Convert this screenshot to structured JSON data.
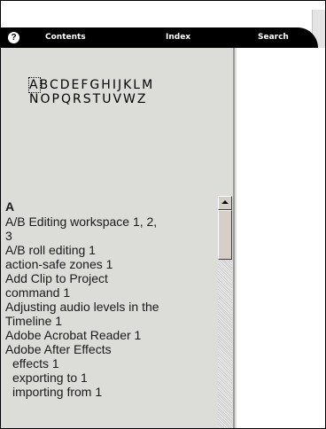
{
  "nav": {
    "help_glyph": "?",
    "contents": "Contents",
    "index": "Index",
    "search": "Search"
  },
  "alphabet": {
    "row1": [
      "A",
      "B",
      "C",
      "D",
      "E",
      "F",
      "G",
      "H",
      "I",
      "J",
      "K",
      "L",
      "M"
    ],
    "row2": [
      "N",
      "O",
      "P",
      "Q",
      "R",
      "S",
      "T",
      "U",
      "V",
      "W",
      "Z"
    ]
  },
  "index": {
    "letter": "A",
    "entries": [
      {
        "text": "A/B Editing workspace 1, 2,",
        "sub": false
      },
      {
        "text": "3",
        "sub": false
      },
      {
        "text": "A/B roll editing 1",
        "sub": false
      },
      {
        "text": "action-safe zones 1",
        "sub": false
      },
      {
        "text": "Add Clip to Project",
        "sub": false
      },
      {
        "text": "command 1",
        "sub": false
      },
      {
        "text": "Adjusting audio levels in the",
        "sub": false
      },
      {
        "text": "Timeline 1",
        "sub": false
      },
      {
        "text": "Adobe Acrobat Reader 1",
        "sub": false
      },
      {
        "text": "Adobe After Effects",
        "sub": false
      },
      {
        "text": "effects 1",
        "sub": true
      },
      {
        "text": "exporting to 1",
        "sub": true
      },
      {
        "text": "importing from 1",
        "sub": true
      }
    ]
  }
}
